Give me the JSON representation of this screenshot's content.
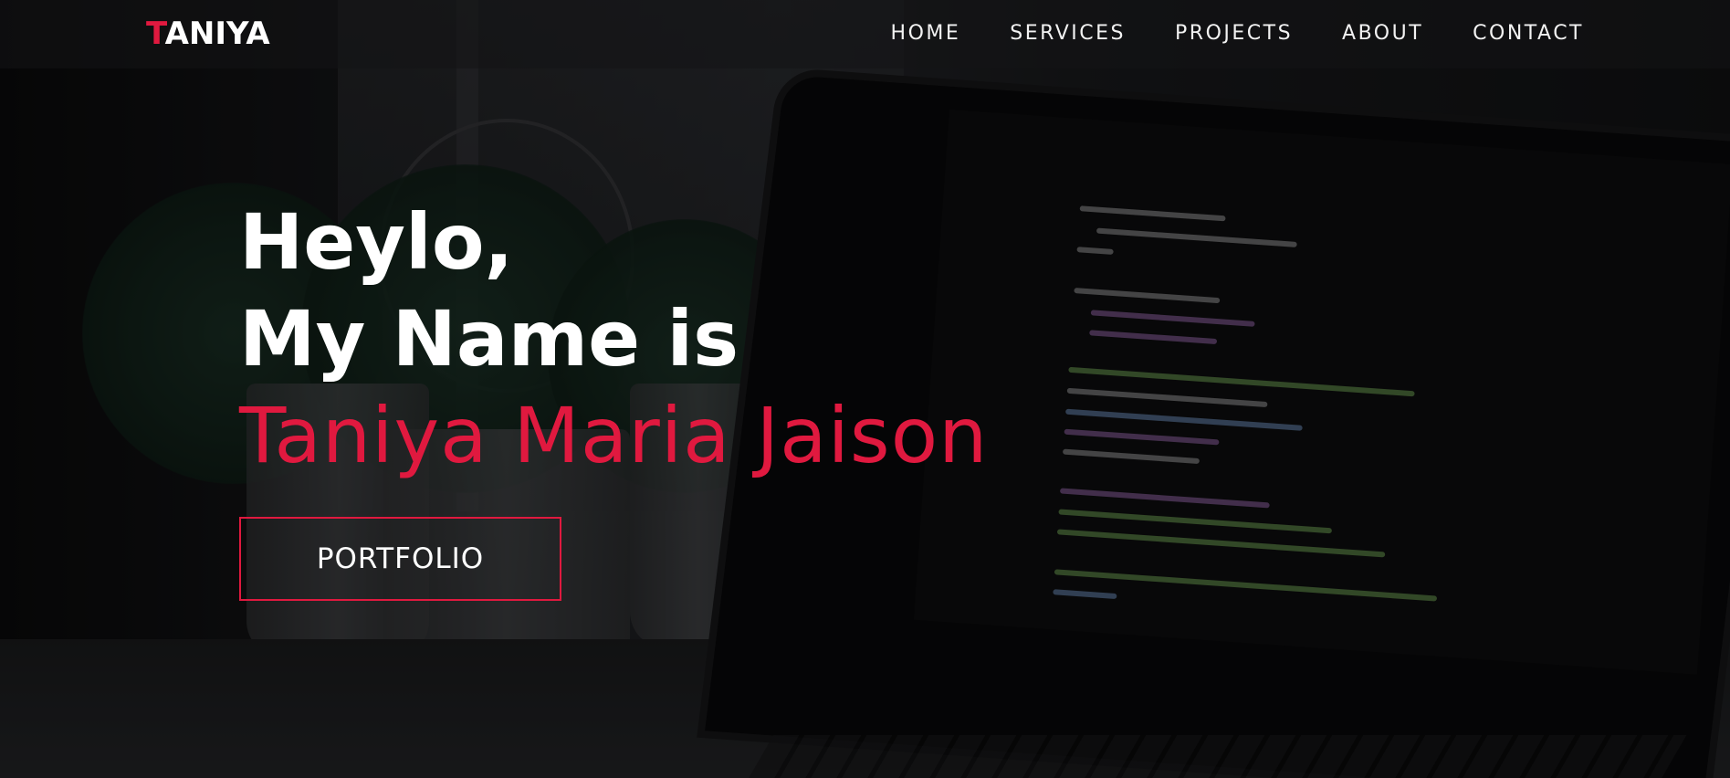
{
  "brand": {
    "logo_first_letter": "T",
    "logo_rest": "ANIYA",
    "accent_color": "#e0193f"
  },
  "nav": {
    "items": [
      {
        "label": "HOME"
      },
      {
        "label": "SERVICES"
      },
      {
        "label": "PROJECTS"
      },
      {
        "label": "ABOUT"
      },
      {
        "label": "CONTACT"
      }
    ]
  },
  "hero": {
    "greeting": "Heylo,",
    "intro": "My Name is",
    "name": "Taniya Maria Jaison",
    "cta_label": "PORTFOLIO"
  }
}
